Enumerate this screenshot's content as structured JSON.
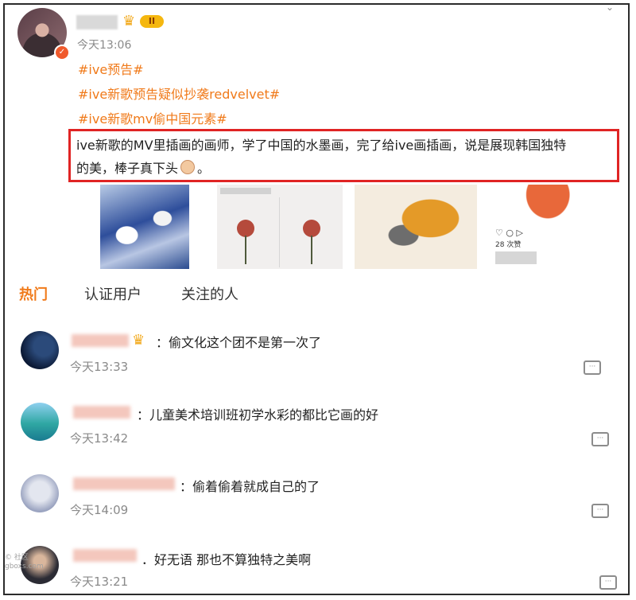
{
  "post": {
    "time": "今天13:06",
    "level": "II",
    "tags": [
      "#ive预告#",
      "#ive新歌预告疑似抄袭redvelvet#",
      "#ive新歌mv偷中国元素#"
    ],
    "text_line1": "ive新歌的MV里插画的画师，学了中国的水墨画，完了给ive画插画，说是展现韩国独特",
    "text_line2_before": "的美，棒子真下头",
    "text_line2_after": "。",
    "images": [
      "image-1",
      "image-2",
      "image-3",
      "image-4"
    ],
    "image4_icons": "♡ ○ ▷",
    "image4_likes": "28 次赞"
  },
  "tabs": [
    "热门",
    "认证用户",
    "关注的人"
  ],
  "comments": [
    {
      "text": "：偷文化这个团不是第一次了",
      "time": "今天13:33"
    },
    {
      "text": "：儿童美术培训班初学水彩的都比它画的好",
      "time": "今天13:42"
    },
    {
      "text": "：偷着偷着就成自己的了",
      "time": "今天14:09"
    },
    {
      "text": "．好无语 那也不算独特之美啊",
      "time": "今天13:21"
    }
  ],
  "watermark": "© 社区\ngboxs.com",
  "colors": {
    "accent": "#f07a1a",
    "highlight_border": "#e02424"
  }
}
